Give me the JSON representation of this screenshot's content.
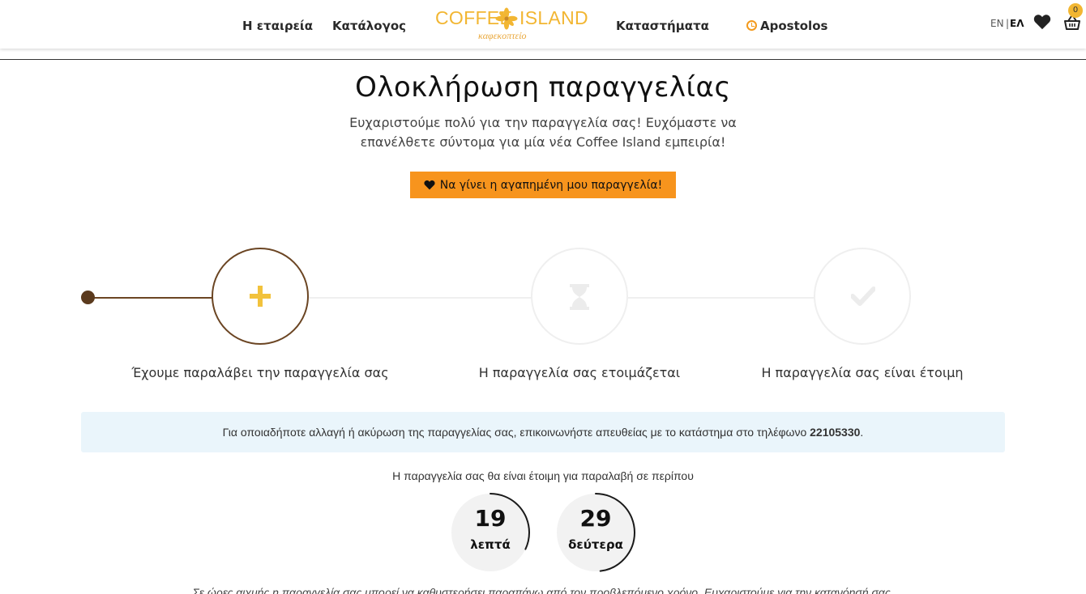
{
  "header": {
    "nav": {
      "company": "Η εταιρεία",
      "catalog": "Κατάλογος",
      "stores": "Καταστήματα",
      "user": "Apostolos"
    },
    "logo": {
      "word_left": "COFFEE",
      "word_right": "ISLAND",
      "subtitle": "καφεκοπτείο"
    },
    "language": {
      "en": "EN",
      "separator": "|",
      "el": "ΕΛ"
    },
    "cart_count": "0",
    "icons": [
      "clock-icon",
      "heart-icon",
      "basket-icon"
    ]
  },
  "main": {
    "title": "Ολοκλήρωση παραγγελίας",
    "subtitle": "Ευχαριστούμε πολύ για την παραγγελία σας! Ευχόμαστε να επανέλθετε σύντομα για μία νέα Coffee Island εμπειρία!",
    "favorite_button": "Να γίνει η αγαπημένη μου παραγγελία!"
  },
  "tracker": {
    "steps": [
      {
        "label": "Έχουμε παραλάβει την παραγγελία σας",
        "icon": "plus-icon",
        "state": "active"
      },
      {
        "label": "Η παραγγελία σας ετοιμάζεται",
        "icon": "hourglass-icon",
        "state": "pending"
      },
      {
        "label": "Η παραγγελία σας είναι έτοιμη",
        "icon": "check-icon",
        "state": "pending"
      }
    ]
  },
  "info": {
    "text": "Για οποιαδήποτε αλλαγή ή ακύρωση της παραγγελίας σας, επικοινωνήστε απευθείας με το κατάστημα στο τηλέφωνο",
    "phone": "22105330",
    "end": "."
  },
  "ready": {
    "text": "Η παραγγελία σας θα είναι έτοιμη για παραλαβή σε περίπου",
    "minutes": {
      "value": "19",
      "unit": "λεπτά",
      "fraction_remaining": 0.32
    },
    "seconds": {
      "value": "29",
      "unit": "δεύτερα",
      "fraction_remaining": 0.48
    }
  },
  "footer_note": "Σε ώρες αιχμής η παραγγελία σας μπορεί να καθυστερήσει παραπάνω από τον προβλεπόμενο χρόνο. Ευχαριστούμε για την κατανόησή σας.",
  "colors": {
    "accent_orange": "#f7941d",
    "brand_gold": "#f2b632",
    "brown": "#6b4523",
    "info_bg": "#eaf5fb"
  }
}
